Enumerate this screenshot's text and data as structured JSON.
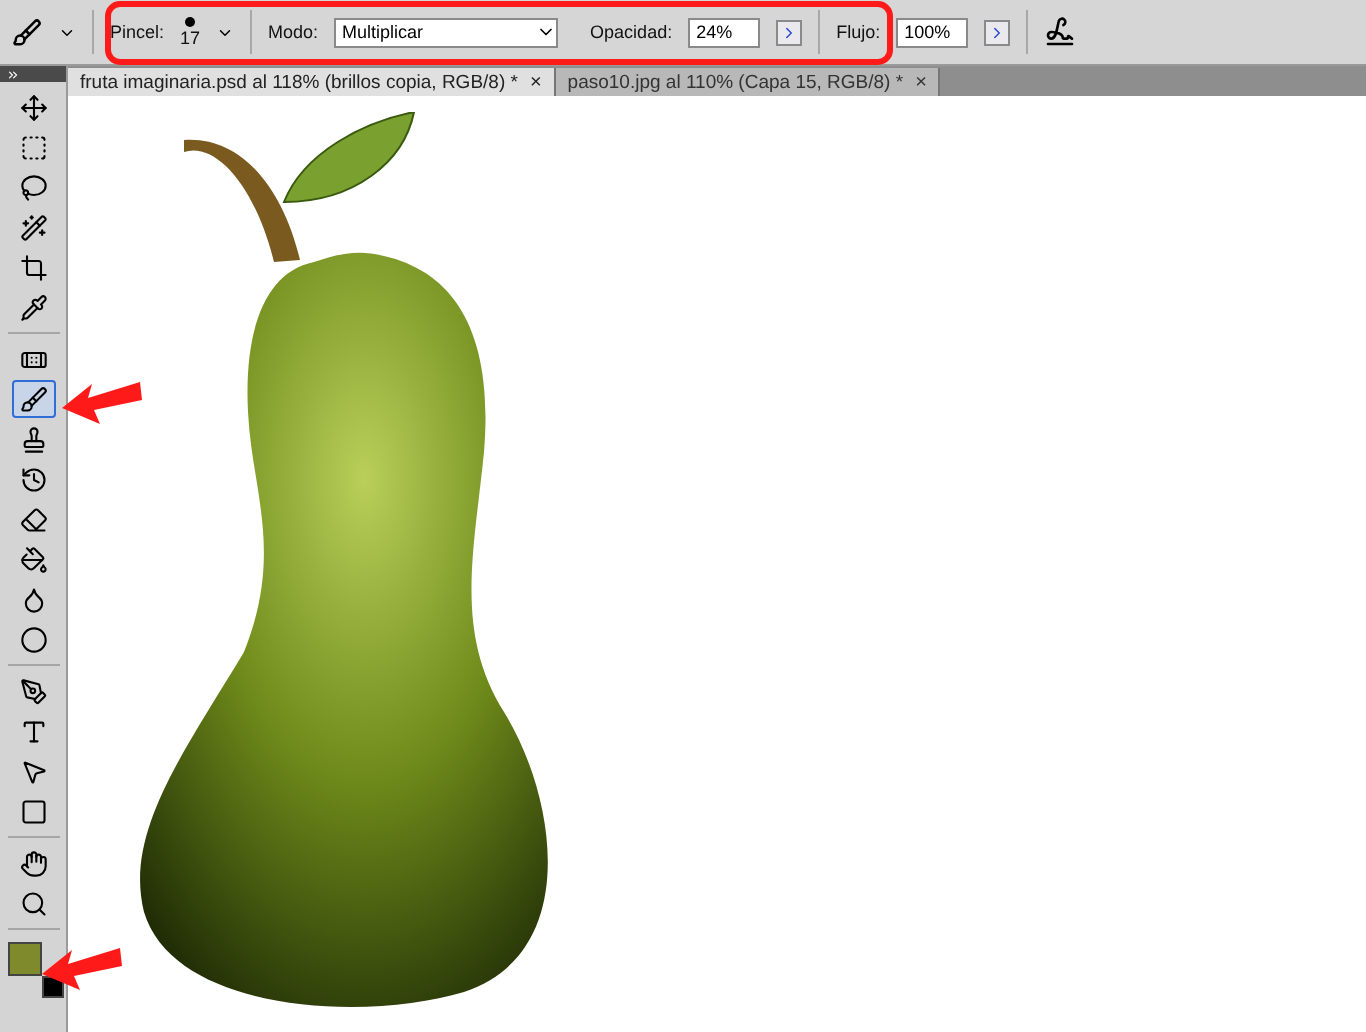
{
  "options_bar": {
    "brush": {
      "label": "Pincel:",
      "size": "17"
    },
    "mode": {
      "label": "Modo:",
      "value": "Multiplicar"
    },
    "opacity": {
      "label": "Opacidad:",
      "value": "24%"
    },
    "flow": {
      "label": "Flujo:",
      "value": "100%"
    }
  },
  "tabs": [
    {
      "label": "fruta imaginaria.psd al 118% (brillos copia, RGB/8) *",
      "close": "×",
      "selected": true
    },
    {
      "label": "paso10.jpg al 110% (Capa 15, RGB/8) *",
      "close": "×",
      "selected": false
    }
  ],
  "tool_groups": [
    {
      "tools": [
        {
          "kind": "move",
          "selected": false
        },
        {
          "kind": "marquee",
          "selected": false
        },
        {
          "kind": "lasso",
          "selected": false
        },
        {
          "kind": "wand",
          "selected": false
        },
        {
          "kind": "crop",
          "selected": false
        },
        {
          "kind": "eyedropper",
          "selected": false
        }
      ]
    },
    {
      "tools": [
        {
          "kind": "heal",
          "selected": false
        },
        {
          "kind": "brush",
          "selected": true
        },
        {
          "kind": "stamp",
          "selected": false
        },
        {
          "kind": "history",
          "selected": false
        },
        {
          "kind": "eraser",
          "selected": false
        },
        {
          "kind": "bucket",
          "selected": false
        },
        {
          "kind": "blur",
          "selected": false
        },
        {
          "kind": "dodge",
          "selected": false
        }
      ]
    },
    {
      "tools": [
        {
          "kind": "pen",
          "selected": false
        },
        {
          "kind": "text",
          "selected": false
        },
        {
          "kind": "path",
          "selected": false
        },
        {
          "kind": "shape",
          "selected": false
        }
      ]
    },
    {
      "tools": [
        {
          "kind": "hand",
          "selected": false
        },
        {
          "kind": "zoom",
          "selected": false
        }
      ]
    }
  ],
  "swatches": [
    {
      "kind": "foreground",
      "color": "#7f8a2c"
    },
    {
      "kind": "background",
      "color": "#000000"
    }
  ]
}
